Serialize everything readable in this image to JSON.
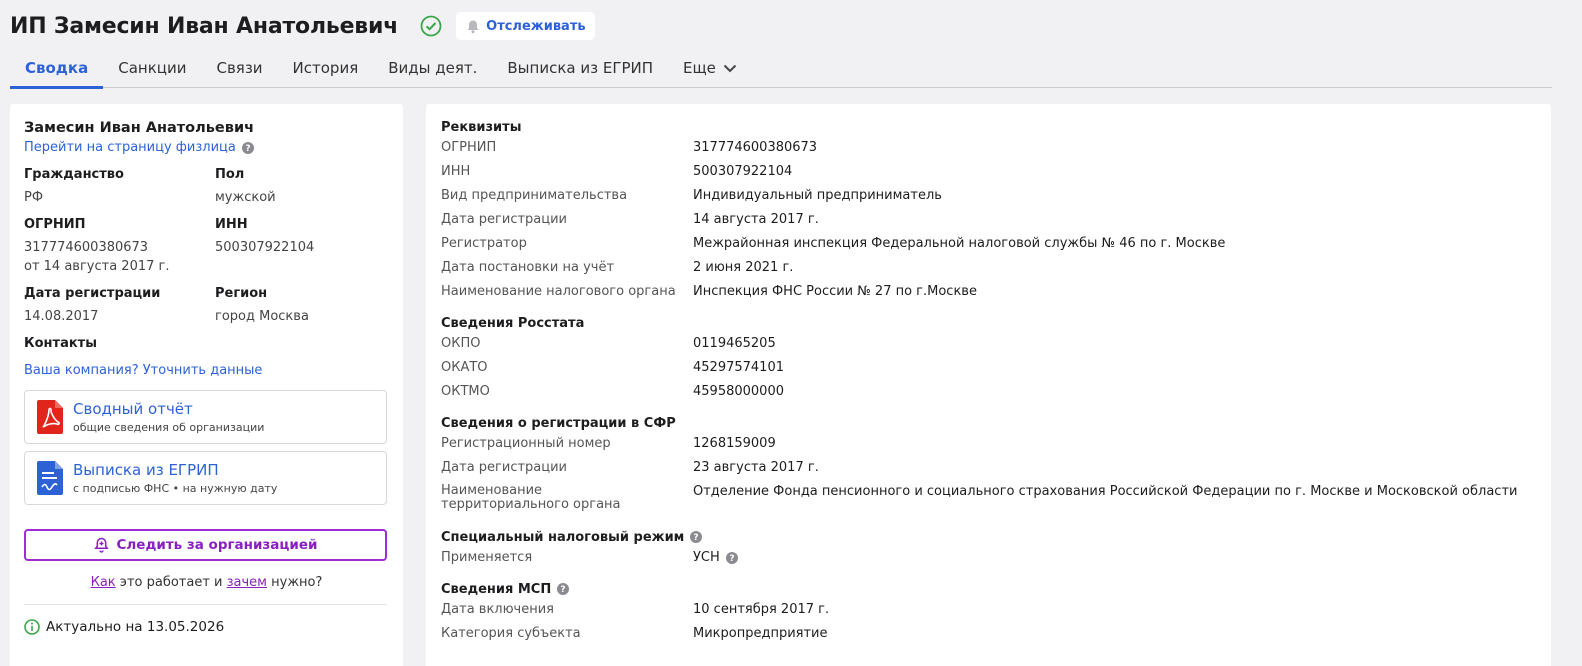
{
  "header": {
    "title": "ИП Замесин Иван Анатольевич",
    "track_label": "Отслеживать"
  },
  "tabs": [
    {
      "label": "Сводка"
    },
    {
      "label": "Санкции"
    },
    {
      "label": "Связи"
    },
    {
      "label": "История"
    },
    {
      "label": "Виды деят."
    },
    {
      "label": "Выписка из ЕГРИП"
    },
    {
      "label": "Еще"
    }
  ],
  "left": {
    "name": "Замесин Иван Анатольевич",
    "person_link": "Перейти на страницу физлица",
    "fields": {
      "citizenship_label": "Гражданство",
      "citizenship_value": "РФ",
      "sex_label": "Пол",
      "sex_value": "мужской",
      "ogrnip_label": "ОГРНИП",
      "ogrnip_value": "317774600380673",
      "ogrnip_date": "от 14 августа 2017 г.",
      "inn_label": "ИНН",
      "inn_value": "500307922104",
      "regdate_label": "Дата регистрации",
      "regdate_value": "14.08.2017",
      "region_label": "Регион",
      "region_value": "город Москва"
    },
    "contacts_label": "Контакты",
    "contacts_link": "Ваша компания? Уточнить данные",
    "cards": [
      {
        "title": "Сводный отчёт",
        "sub": "общие сведения об организации",
        "icon": "pdf-icon"
      },
      {
        "title": "Выписка из ЕГРИП",
        "sub": "с подписью ФНС • на нужную дату",
        "icon": "document-icon"
      }
    ],
    "follow_label": "Следить за организацией",
    "howto": {
      "how": "Как",
      "middle": " это работает и ",
      "why": "зачем",
      "end": " нужно?"
    },
    "actual": "Актуально на 13.05.2026"
  },
  "right": {
    "sections": [
      {
        "title": "Реквизиты",
        "help": false,
        "rows": [
          {
            "k": "ОГРНИП",
            "v": "317774600380673"
          },
          {
            "k": "ИНН",
            "v": "500307922104"
          },
          {
            "k": "Вид предпринимательства",
            "v": "Индивидуальный предприниматель"
          },
          {
            "k": "Дата регистрации",
            "v": "14 августа 2017 г."
          },
          {
            "k": "Регистратор",
            "v": "Межрайонная инспекция Федеральной налоговой службы № 46 по г. Москве"
          },
          {
            "k": "Дата постановки на учёт",
            "v": "2 июня 2021 г."
          },
          {
            "k": "Наименование налогового органа",
            "v": "Инспекция ФНС России № 27 по г.Москве"
          }
        ]
      },
      {
        "title": "Сведения Росстата",
        "help": false,
        "rows": [
          {
            "k": "ОКПО",
            "v": "0119465205"
          },
          {
            "k": "ОКАТО",
            "v": "45297574101"
          },
          {
            "k": "ОКТМО",
            "v": "45958000000"
          }
        ]
      },
      {
        "title": "Сведения о регистрации в СФР",
        "help": false,
        "rows": [
          {
            "k": "Регистрационный номер",
            "v": "1268159009"
          },
          {
            "k": "Дата регистрации",
            "v": "23 августа 2017 г."
          },
          {
            "k": "Наименование территориального органа",
            "v": "Отделение Фонда пенсионного и социального страхования Российской Федерации по г. Москве и Московской области"
          }
        ]
      },
      {
        "title": "Специальный налоговый режим",
        "help": true,
        "rows": [
          {
            "k": "Применяется",
            "v": "УСН",
            "help": true
          }
        ]
      },
      {
        "title": "Сведения МСП",
        "help": true,
        "rows": [
          {
            "k": "Дата включения",
            "v": "10 сентября 2017 г."
          },
          {
            "k": "Категория субъекта",
            "v": "Микропредприятие"
          }
        ]
      }
    ]
  },
  "colors": {
    "accent": "#2d62d6",
    "follow": "#a02bd4",
    "verified": "#3aa64a",
    "pdf": "#e0261c"
  }
}
